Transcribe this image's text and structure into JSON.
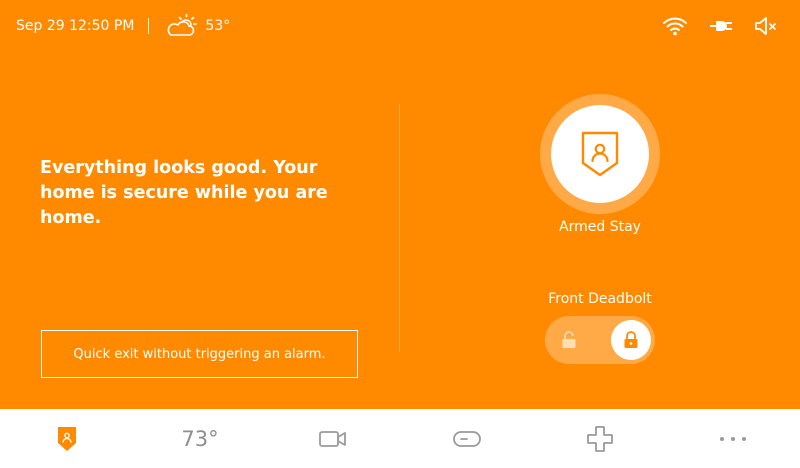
{
  "status": {
    "datetime": "Sep 29 12:50 PM",
    "weather_icon": "partly-cloudy-icon",
    "outside_temp": "53°",
    "icons": [
      "wifi-icon",
      "power-plug-icon",
      "speaker-muted-icon"
    ]
  },
  "message": "Everything looks good. Your home is secure while you are home.",
  "quick_exit_label": "Quick exit without triggering an alarm.",
  "security": {
    "mode_label": "Armed Stay",
    "icon": "shield-user-icon"
  },
  "lock": {
    "label": "Front Deadbolt",
    "state": "locked"
  },
  "nav": {
    "items": [
      {
        "name": "security",
        "icon": "shield-user-icon"
      },
      {
        "name": "thermostat",
        "label": "73°"
      },
      {
        "name": "cameras",
        "icon": "video-camera-icon"
      },
      {
        "name": "devices",
        "icon": "switch-icon"
      },
      {
        "name": "add",
        "icon": "plus-icon"
      },
      {
        "name": "more",
        "icon": "more-dots-icon"
      }
    ]
  },
  "colors": {
    "accent": "#FF8A00",
    "nav_icon": "#9A9A9A"
  }
}
